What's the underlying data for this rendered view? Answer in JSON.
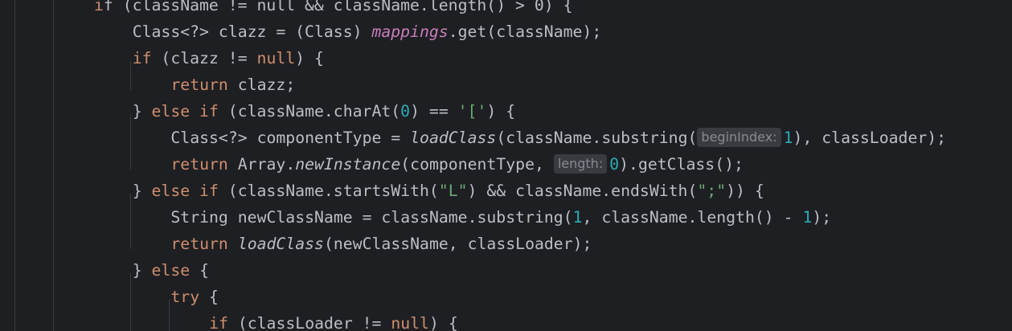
{
  "editor": {
    "lines": [
      {
        "indent": 1,
        "tokens": [
          {
            "t": "i",
            "c": "kw"
          },
          {
            "t": "f (className != null && className.length() > 0) {",
            "c": ""
          }
        ]
      },
      {
        "indent": 2,
        "tokens": [
          {
            "t": "Class<?> clazz = (Class) ",
            "c": ""
          },
          {
            "t": "mappings",
            "c": "fld"
          },
          {
            "t": ".get(className);",
            "c": ""
          }
        ]
      },
      {
        "indent": 2,
        "tokens": [
          {
            "t": "if",
            "c": "kw"
          },
          {
            "t": " (clazz != ",
            "c": ""
          },
          {
            "t": "null",
            "c": "kw"
          },
          {
            "t": ") {",
            "c": ""
          }
        ]
      },
      {
        "indent": 3,
        "tokens": [
          {
            "t": "return",
            "c": "kw"
          },
          {
            "t": " clazz;",
            "c": ""
          }
        ]
      },
      {
        "indent": 2,
        "tokens": [
          {
            "t": "} ",
            "c": ""
          },
          {
            "t": "else if",
            "c": "kw"
          },
          {
            "t": " (className.charAt(",
            "c": ""
          },
          {
            "t": "0",
            "c": "num"
          },
          {
            "t": ") == ",
            "c": ""
          },
          {
            "t": "'['",
            "c": "str"
          },
          {
            "t": ") {",
            "c": ""
          }
        ]
      },
      {
        "indent": 3,
        "tokens": [
          {
            "t": "Class<?> componentType = ",
            "c": ""
          },
          {
            "t": "loadClass",
            "c": "st"
          },
          {
            "t": "(className.substring(",
            "c": ""
          },
          {
            "t": "beginIndex:",
            "c": "hint"
          },
          {
            "t": "1",
            "c": "num"
          },
          {
            "t": "), classLoader);",
            "c": ""
          }
        ]
      },
      {
        "indent": 3,
        "tokens": [
          {
            "t": "return",
            "c": "kw"
          },
          {
            "t": " Array.",
            "c": ""
          },
          {
            "t": "newInstance",
            "c": "st"
          },
          {
            "t": "(componentType, ",
            "c": ""
          },
          {
            "t": "length:",
            "c": "hint"
          },
          {
            "t": "0",
            "c": "num"
          },
          {
            "t": ").getClass();",
            "c": ""
          }
        ]
      },
      {
        "indent": 2,
        "tokens": [
          {
            "t": "} ",
            "c": ""
          },
          {
            "t": "else if",
            "c": "kw"
          },
          {
            "t": " (className.startsWith(",
            "c": ""
          },
          {
            "t": "\"L\"",
            "c": "str"
          },
          {
            "t": ") && className.endsWith(",
            "c": ""
          },
          {
            "t": "\";\"",
            "c": "str"
          },
          {
            "t": ")) {",
            "c": ""
          }
        ]
      },
      {
        "indent": 3,
        "tokens": [
          {
            "t": "String newClassName = className.substring(",
            "c": ""
          },
          {
            "t": "1",
            "c": "num"
          },
          {
            "t": ", className.length() - ",
            "c": ""
          },
          {
            "t": "1",
            "c": "num"
          },
          {
            "t": ");",
            "c": ""
          }
        ]
      },
      {
        "indent": 3,
        "tokens": [
          {
            "t": "return",
            "c": "kw"
          },
          {
            "t": " ",
            "c": ""
          },
          {
            "t": "loadClass",
            "c": "st"
          },
          {
            "t": "(newClassName, classLoader);",
            "c": ""
          }
        ]
      },
      {
        "indent": 2,
        "tokens": [
          {
            "t": "} ",
            "c": ""
          },
          {
            "t": "else",
            "c": "kw"
          },
          {
            "t": " {",
            "c": ""
          }
        ]
      },
      {
        "indent": 3,
        "tokens": [
          {
            "t": "try",
            "c": "kw"
          },
          {
            "t": " {",
            "c": ""
          }
        ]
      },
      {
        "indent": 4,
        "tokens": [
          {
            "t": "if",
            "c": "kw"
          },
          {
            "t": " (classLoader != ",
            "c": ""
          },
          {
            "t": "null",
            "c": "kw"
          },
          {
            "t": ") {",
            "c": ""
          }
        ]
      }
    ]
  }
}
